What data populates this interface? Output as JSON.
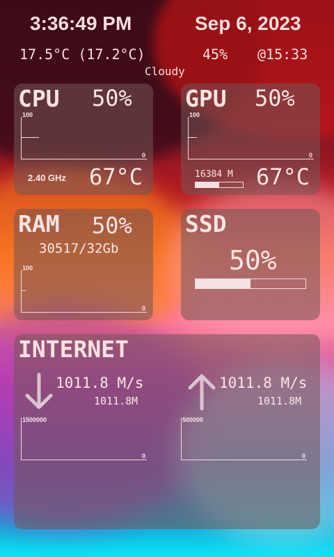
{
  "header": {
    "time": "3:36:49 PM",
    "date": "Sep 6, 2023",
    "temperature": "17.5°C (17.2°C)",
    "humidity": "45%",
    "updated": "@15:33",
    "condition": "Cloudy"
  },
  "cpu": {
    "title": "CPU",
    "usage": "50%",
    "graph_max": "100",
    "graph_min": "0",
    "frequency": "2.40 GHz",
    "temperature": "67°C",
    "level": 0.5
  },
  "gpu": {
    "title": "GPU",
    "usage": "50%",
    "graph_max": "100",
    "graph_min": "0",
    "memory": "16384 M",
    "memory_fill": 0.5,
    "temperature": "67°C",
    "level": 0.5
  },
  "ram": {
    "title": "RAM",
    "usage": "50%",
    "amount": "30517/32Gb",
    "graph_max": "100",
    "graph_min": "0",
    "level": 0.5
  },
  "ssd": {
    "title": "SSD",
    "usage": "50%",
    "fill": 0.5
  },
  "internet": {
    "title": "INTERNET",
    "download_speed": "1011.8 M/s",
    "download_total": "1011.8M",
    "upload_speed": "1011.8 M/s",
    "upload_total": "1011.8M",
    "download_graph_max": "1500000",
    "download_graph_min": "0",
    "upload_graph_max": "500000",
    "upload_graph_min": "0",
    "download_icon": "arrow-down-icon",
    "upload_icon": "arrow-up-icon"
  }
}
